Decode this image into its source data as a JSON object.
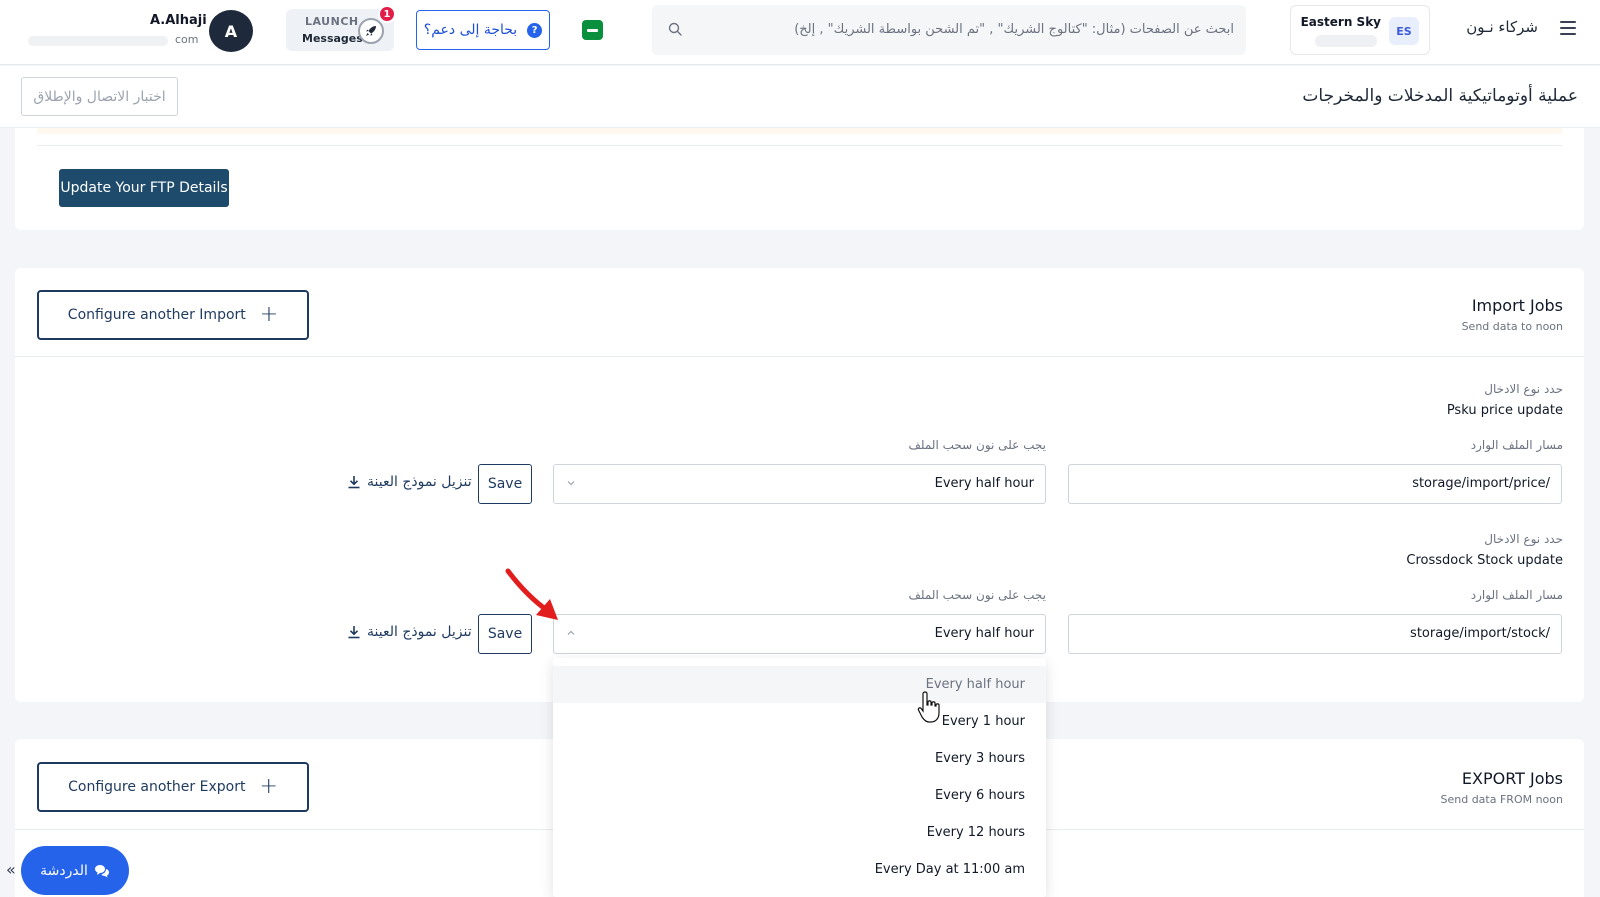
{
  "topbar": {
    "brand": "شركاء نـون",
    "account_badge": "ES",
    "account_name": "Eastern Sky",
    "search_placeholder": "ابحث عن الصفحات (مثال: \"كتالوج الشريك\" , \"تم الشحن بواسطة الشريك\" , إلخ)",
    "help_label": "بحاجة إلى دعم؟",
    "launch_line1": "LAUNCH",
    "launch_line2": "Messages",
    "launch_badge": "1",
    "avatar_initial": "A",
    "user_name": "A.Alhaji",
    "user_email_suffix": "com"
  },
  "page": {
    "title": "عملية أوتوماتيكية المدخلات والمخرجات",
    "test_button": "اختبار الاتصال والإطلاق",
    "ftp_button": "Update Your FTP Details"
  },
  "import": {
    "title": "Import Jobs",
    "subtitle": "Send data to noon",
    "configure_button": "Configure another Import",
    "jobs": [
      {
        "type_label": "حدد نوع الادخال",
        "type_value": "Psku price update",
        "path_label": "مسار الملف الوارد",
        "path_value": "storage/import/price/",
        "freq_label": "يجب على نون سحب الملف",
        "freq_value": "Every half hour",
        "save_label": "Save",
        "download_label": "تنزيل نموذج العينة"
      },
      {
        "type_label": "حدد نوع الادخال",
        "type_value": "Crossdock Stock update",
        "path_label": "مسار الملف الوارد",
        "path_value": "storage/import/stock/",
        "freq_label": "يجب على نون سحب الملف",
        "freq_value": "Every half hour",
        "save_label": "Save",
        "download_label": "تنزيل نموذج العينة"
      }
    ]
  },
  "dropdown": {
    "options": [
      "Every half hour",
      "Every 1 hour",
      "Every 3 hours",
      "Every 6 hours",
      "Every 12 hours",
      "Every Day at 11:00 am"
    ],
    "hovered_index": 0
  },
  "export": {
    "title": "EXPORT Jobs",
    "subtitle": "Send data FROM noon",
    "configure_button": "Configure another Export"
  },
  "chat": {
    "label": "الدردشة",
    "collapse": "«"
  },
  "colors": {
    "primary_dark": "#1e4b6b",
    "navy": "#1e3a5f",
    "chat_blue": "#2563eb",
    "arrow_red": "#e21d1d"
  }
}
